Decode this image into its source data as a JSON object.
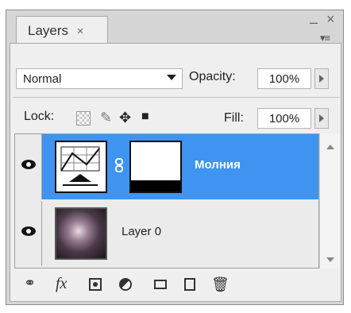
{
  "panel": {
    "tab_label": "Layers",
    "tab_close": "×",
    "window_minimize": "–",
    "window_close": "×",
    "panel_menu": "▾≡"
  },
  "controls": {
    "blend_mode": "Normal",
    "opacity_label": "Opacity:",
    "opacity_value": "100%",
    "lock_label": "Lock:",
    "fill_label": "Fill:",
    "fill_value": "100%"
  },
  "layers": [
    {
      "name": "Молния",
      "selected": true,
      "visible": true,
      "type": "adjustment-curves"
    },
    {
      "name": "Layer 0",
      "selected": false,
      "visible": true,
      "type": "image"
    }
  ],
  "footer": {
    "fx_label": "fx"
  },
  "colors": {
    "selected_row": "#3e94f0",
    "panel_bg": "#d6d6d6",
    "content_bg": "#efefef"
  },
  "icons": [
    "link-layers-icon",
    "fx-icon",
    "add-mask-icon",
    "adjustment-layer-icon",
    "new-group-icon",
    "new-layer-icon",
    "trash-icon"
  ]
}
